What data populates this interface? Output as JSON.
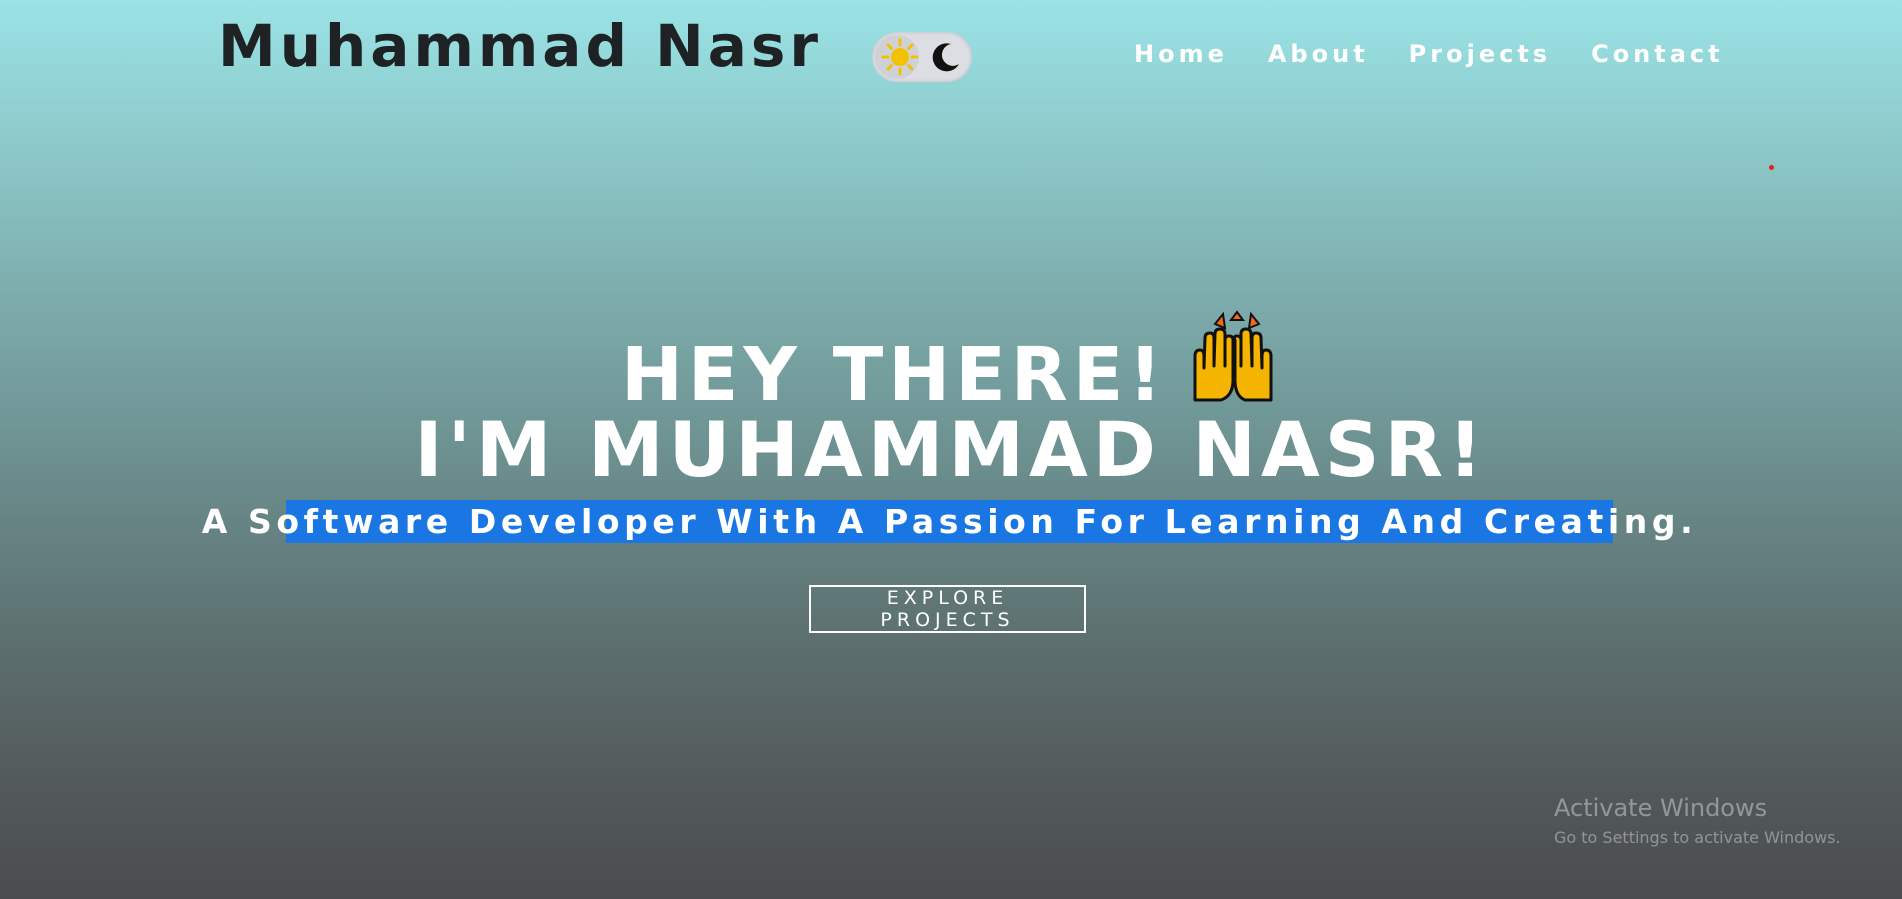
{
  "header": {
    "brand": "Muhammad Nasr",
    "theme_toggle": {
      "light_icon": "sun-icon",
      "dark_icon": "moon-icon",
      "state": "light"
    },
    "nav": [
      "Home",
      "About",
      "Projects",
      "Contact"
    ]
  },
  "hero": {
    "line1": "HEY THERE!",
    "line1_emoji": "raising-hands-emoji",
    "line2": "I'M MUHAMMAD NASR!",
    "tagline": "A Software Developer With A Passion For Learning And Creating.",
    "cta_label": "EXPLORE PROJECTS"
  },
  "watermark": {
    "title": "Activate Windows",
    "subtitle": "Go to Settings to activate Windows."
  },
  "colors": {
    "gradient_top": "#9ae3e6",
    "gradient_bottom": "#4a4c4e",
    "selection_highlight": "#1976e3",
    "brand_text": "#1f2224",
    "cursor_dot": "#e0221b"
  }
}
